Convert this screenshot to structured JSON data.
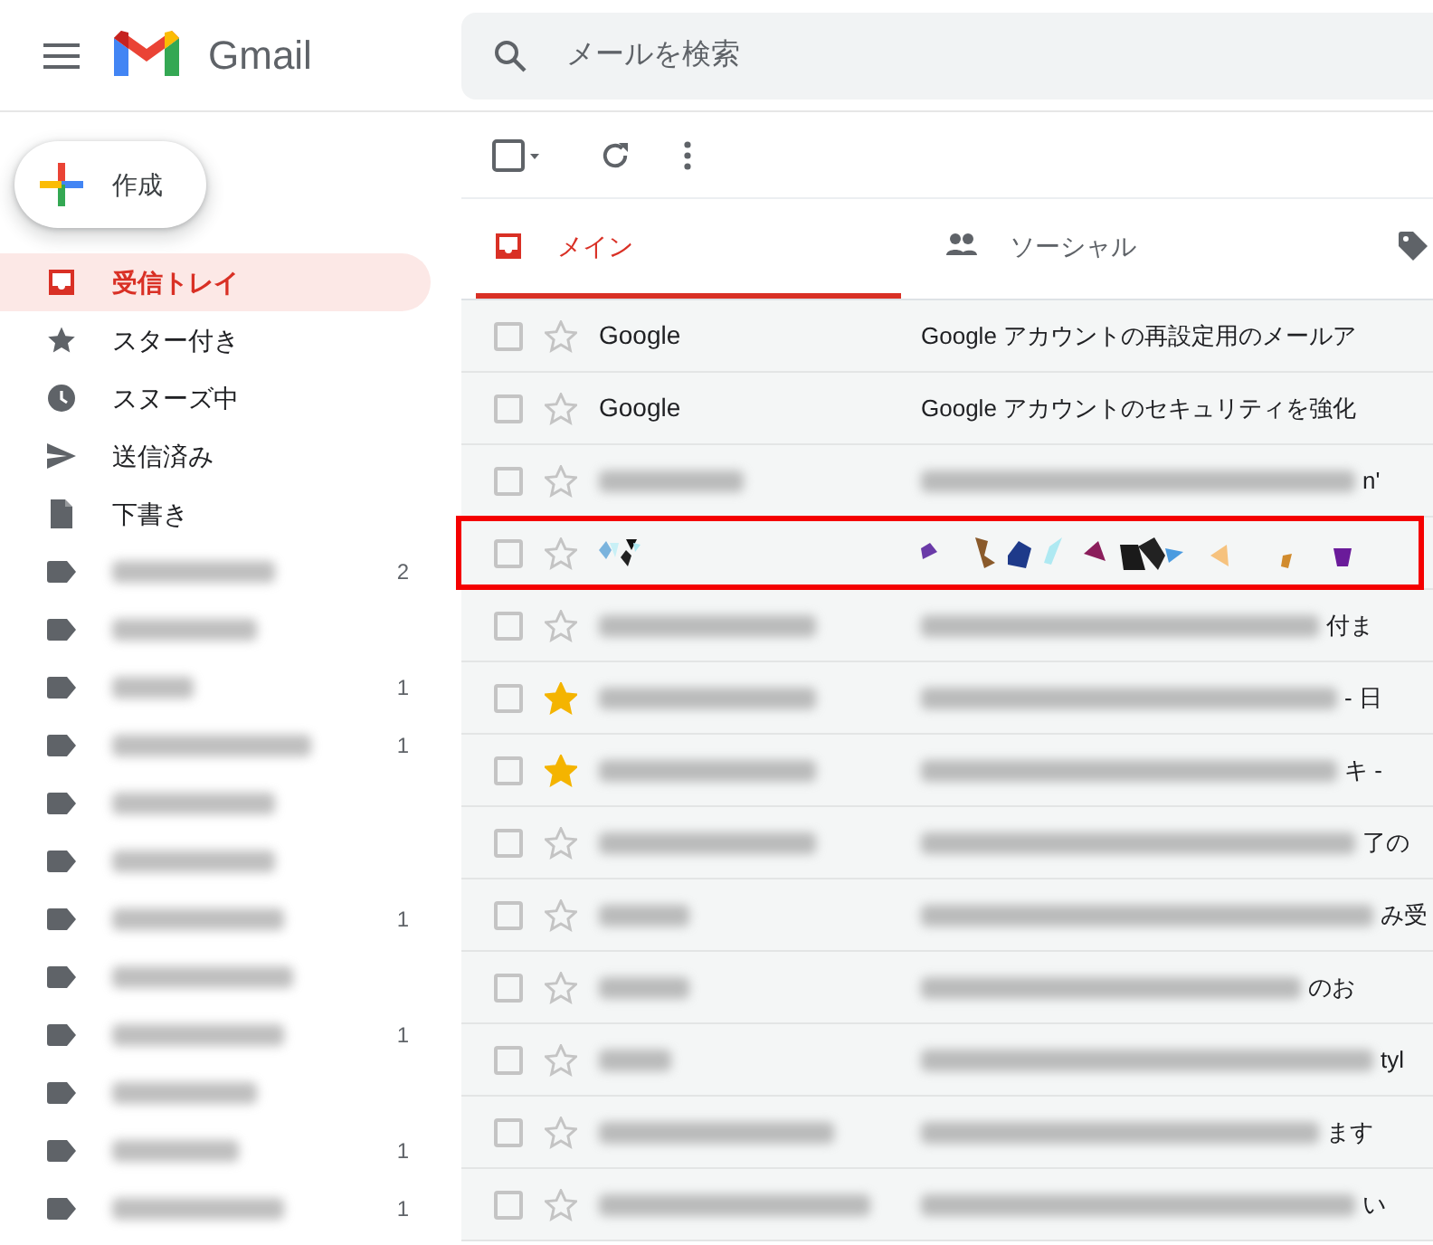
{
  "header": {
    "app_name": "Gmail",
    "search": {
      "placeholder": "メールを検索"
    }
  },
  "compose": {
    "label": "作成"
  },
  "sidebar": {
    "items": [
      {
        "kind": "inbox",
        "label": "受信トレイ",
        "selected": true
      },
      {
        "kind": "star",
        "label": "スター付き",
        "selected": false
      },
      {
        "kind": "snooze",
        "label": "スヌーズ中",
        "selected": false
      },
      {
        "kind": "sent",
        "label": "送信済み",
        "selected": false
      },
      {
        "kind": "draft",
        "label": "下書き",
        "selected": false
      }
    ],
    "labels": [
      {
        "kind": "label",
        "count": "2"
      },
      {
        "kind": "label"
      },
      {
        "kind": "label",
        "count": "1"
      },
      {
        "kind": "label",
        "count": "1"
      },
      {
        "kind": "label"
      },
      {
        "kind": "label"
      },
      {
        "kind": "label",
        "count": "1"
      },
      {
        "kind": "label"
      },
      {
        "kind": "label",
        "count": "1"
      },
      {
        "kind": "label"
      },
      {
        "kind": "label",
        "count": "1"
      },
      {
        "kind": "label",
        "count": "1"
      }
    ]
  },
  "tabs": [
    {
      "kind": "primary",
      "label": "メイン",
      "selected": true
    },
    {
      "kind": "social",
      "label": "ソーシャル",
      "selected": false
    },
    {
      "kind": "promotions",
      "selected": false
    }
  ],
  "emails": [
    {
      "kind": "plain",
      "sender": "Google",
      "subject": "Google アカウントの再設定用のメールア",
      "checked": false,
      "starred": false,
      "highlighted": false
    },
    {
      "kind": "plain",
      "sender": "Google",
      "subject": "Google アカウントのセキュリティを強化",
      "checked": false,
      "starred": false,
      "highlighted": false
    },
    {
      "kind": "blurred",
      "subject_tail": "n'",
      "checked": false,
      "starred": false,
      "highlighted": false
    },
    {
      "kind": "pixelated",
      "checked": false,
      "starred": false,
      "highlighted": true
    },
    {
      "kind": "blurred",
      "subject_tail": "付ま",
      "checked": false,
      "starred": false,
      "highlighted": false
    },
    {
      "kind": "blurred",
      "subject_tail": "- 日",
      "checked": false,
      "starred": true,
      "highlighted": false
    },
    {
      "kind": "blurred",
      "subject_tail": "キ -",
      "checked": false,
      "starred": true,
      "highlighted": false
    },
    {
      "kind": "blurred",
      "subject_tail": "了の",
      "checked": false,
      "starred": false,
      "highlighted": false
    },
    {
      "kind": "blurred",
      "subject_tail": "み受",
      "checked": false,
      "starred": false,
      "highlighted": false
    },
    {
      "kind": "blurred",
      "subject_tail": "のお",
      "checked": false,
      "starred": false,
      "highlighted": false
    },
    {
      "kind": "blurred",
      "subject_tail": "tyl",
      "checked": false,
      "starred": false,
      "highlighted": false
    },
    {
      "kind": "blurred",
      "subject_tail": "ます",
      "checked": false,
      "starred": false,
      "highlighted": false
    },
    {
      "kind": "blurred",
      "subject_tail": "い",
      "checked": false,
      "starred": false,
      "highlighted": false
    }
  ]
}
